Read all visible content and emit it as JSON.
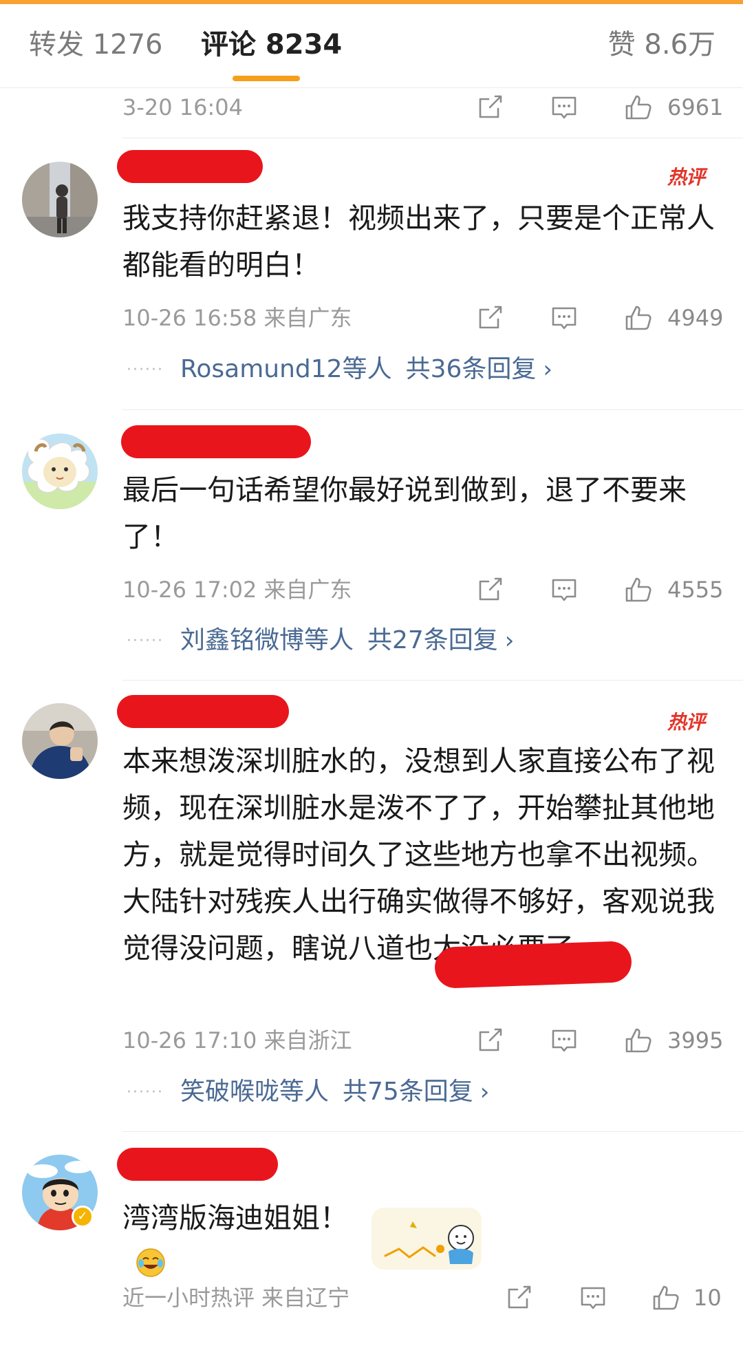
{
  "tabs": {
    "repost": "转发 1276",
    "comments": "评论 8234",
    "likes": "赞 8.6万"
  },
  "colors": {
    "accent": "#f59f1a",
    "reply_link": "#4a6a93",
    "hot_badge": "#e3352b",
    "redaction": "#e8161c"
  },
  "icons": [
    "share-icon",
    "comment-icon",
    "thumbs-up-icon",
    "chevron-right-icon",
    "laugh-cry-emoji"
  ],
  "previous_comment": {
    "meta": "3-20 16:04",
    "likes": "6961"
  },
  "comments": [
    {
      "hot_badge": "热评",
      "text": "我支持你赶紧退！视频出来了，只要是个正常人都能看的明白！",
      "meta": "10-26 16:58 来自广东",
      "likes": "4949",
      "reply_dots": "······",
      "reply_users": "Rosamund12等人",
      "reply_count": "共36条回复",
      "reply_chevron": "›"
    },
    {
      "text": "最后一句话希望你最好说到做到，退了不要来了！",
      "meta": "10-26 17:02 来自广东",
      "likes": "4555",
      "reply_dots": "······",
      "reply_users": "刘鑫铭微博等人",
      "reply_count": "共27条回复",
      "reply_chevron": "›"
    },
    {
      "hot_badge": "热评",
      "text": "本来想泼深圳脏水的，没想到人家直接公布了视频，现在深圳脏水是泼不了了，开始攀扯其他地方，就是觉得时间久了这些地方也拿不出视频。大陆针对残疾人出行确实做得不够好，客观说我觉得没问题，瞎说八道也太没必要了。",
      "meta": "10-26 17:10 来自浙江",
      "likes": "3995",
      "reply_dots": "······",
      "reply_users": "笑破喉咙等人",
      "reply_count": "共75条回复",
      "reply_chevron": "›"
    },
    {
      "text": "湾湾版海迪姐姐！",
      "meta": "近一小时热评 来自辽宁",
      "likes": "10"
    }
  ]
}
